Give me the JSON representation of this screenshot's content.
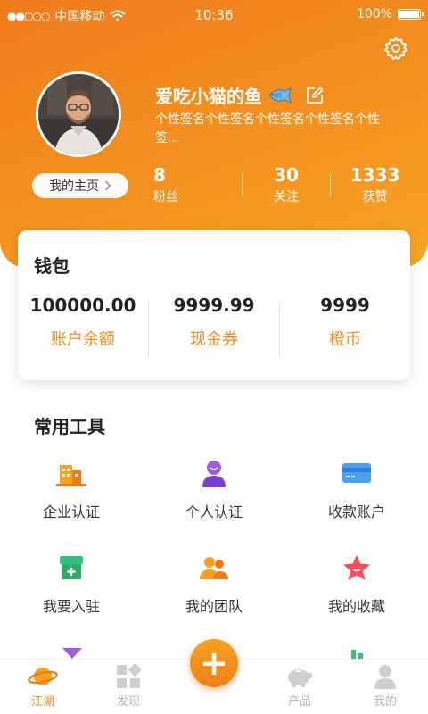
{
  "status_bar": {
    "signal_dots": "●●○○○",
    "carrier": "中国移动",
    "time": "10:36",
    "battery": "100%"
  },
  "profile": {
    "nickname": "爱吃小猫的鱼",
    "signature": "个性签名个性签名个性签名个性签名个性签...",
    "homepage_label": "我的主页",
    "stats": [
      {
        "value": "8",
        "label": "粉丝"
      },
      {
        "value": "30",
        "label": "关注"
      },
      {
        "value": "1333",
        "label": "获赞"
      }
    ]
  },
  "wallet": {
    "title": "钱包",
    "items": [
      {
        "value": "100000.00",
        "label": "账户余额"
      },
      {
        "value": "9999.99",
        "label": "现金券"
      },
      {
        "value": "9999",
        "label": "橙币"
      }
    ]
  },
  "tools": {
    "title": "常用工具",
    "items": [
      {
        "label": "企业认证",
        "icon": "building-icon"
      },
      {
        "label": "个人认证",
        "icon": "person-icon"
      },
      {
        "label": "收款账户",
        "icon": "card-icon"
      },
      {
        "label": "我要入驻",
        "icon": "store-icon"
      },
      {
        "label": "我的团队",
        "icon": "team-icon"
      },
      {
        "label": "我的收藏",
        "icon": "star-icon"
      }
    ]
  },
  "tabbar": {
    "tabs": [
      {
        "label": "江湖",
        "icon": "planet-icon",
        "active": true
      },
      {
        "label": "发现",
        "icon": "discover-icon",
        "active": false
      },
      {
        "label": "产品",
        "icon": "piggybank-icon",
        "active": false
      },
      {
        "label": "我的",
        "icon": "user-icon",
        "active": false
      }
    ],
    "fab_label": "+"
  },
  "colors": {
    "brand": "#f08a1c",
    "header_start": "#f07b1d",
    "header_end": "#f7a524"
  }
}
